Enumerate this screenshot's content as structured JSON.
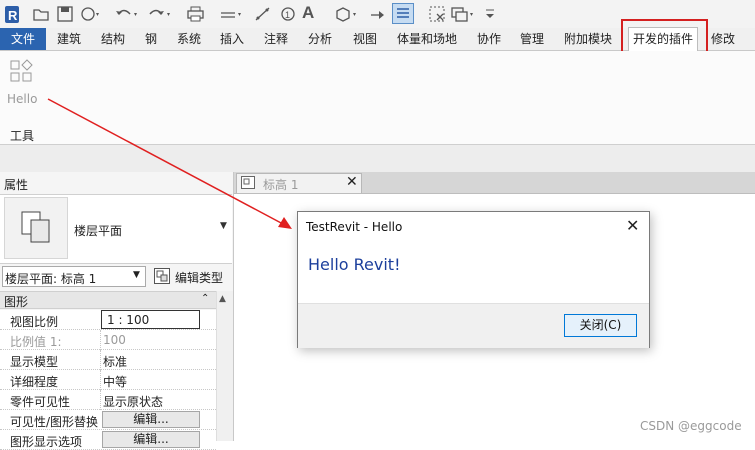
{
  "quick_access": {
    "icons": [
      "revit-logo-icon",
      "open-icon",
      "save-icon",
      "sync-icon",
      "undo-icon",
      "redo-icon",
      "print-icon",
      "measure-icon",
      "dimension-icon",
      "tag-icon",
      "text-icon",
      "3d-view-icon",
      "section-icon",
      "thin-lines-icon",
      "close-hidden-icon",
      "switch-windows-icon",
      "customize-dropdown-icon"
    ],
    "logo_letter": "R",
    "text_tool": "A"
  },
  "ribbon": {
    "tabs": [
      "文件",
      "建筑",
      "结构",
      "钢",
      "系统",
      "插入",
      "注释",
      "分析",
      "视图",
      "体量和场地",
      "协作",
      "管理",
      "附加模块",
      "开发的插件",
      "修改"
    ],
    "active_tab": "开发的插件",
    "hello_button_label": "Hello",
    "panel_label": "工具"
  },
  "properties": {
    "title": "属性",
    "type_name": "楼层平面",
    "instance_selector": "楼层平面: 标高 1",
    "edit_type_label": "编辑类型",
    "category": "图形",
    "rows": [
      {
        "name": "视图比例",
        "value": "1 : 100",
        "kind": "input"
      },
      {
        "name": "比例值 1:",
        "value": "100",
        "kind": "readonly"
      },
      {
        "name": "显示模型",
        "value": "标准",
        "kind": "text"
      },
      {
        "name": "详细程度",
        "value": "中等",
        "kind": "text"
      },
      {
        "name": "零件可见性",
        "value": "显示原状态",
        "kind": "text"
      },
      {
        "name": "可见性/图形替换",
        "value": "编辑...",
        "kind": "button"
      },
      {
        "name": "图形显示选项",
        "value": "编辑...",
        "kind": "button"
      }
    ]
  },
  "view": {
    "tab_label": "标高 1",
    "close_glyph": "✕"
  },
  "dialog": {
    "title": "TestRevit - Hello",
    "message": "Hello Revit!",
    "close_button": "关闭(C)",
    "close_glyph": "✕"
  },
  "watermark": "CSDN @eggcode",
  "colors": {
    "file_tab": "#2b64b0",
    "highlight_box": "#d42020",
    "annotation_arrow": "#e02020",
    "dialog_message": "#1c3f9c"
  }
}
